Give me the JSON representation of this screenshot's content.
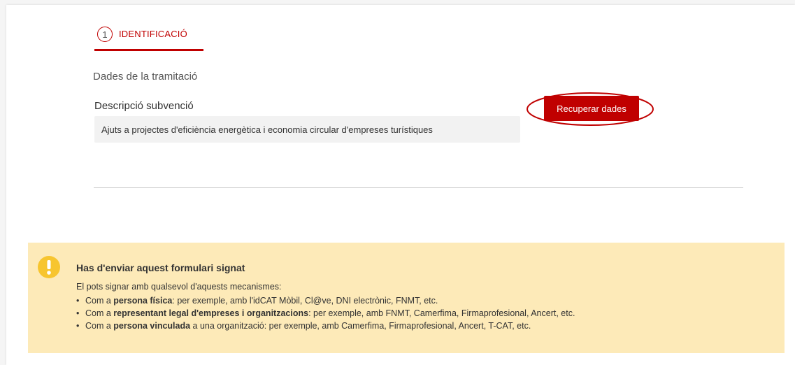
{
  "step": {
    "number": "1",
    "label": "IDENTIFICACIÓ"
  },
  "section": {
    "title": "Dades de la tramitació"
  },
  "field": {
    "label": "Descripció subvenció",
    "value": "Ajuts a projectes d'eficiència energètica i economia circular d'empreses turístiques"
  },
  "actions": {
    "recover_label": "Recuperar dades"
  },
  "notice": {
    "icon": "exclamation-icon",
    "title": "Has d'enviar aquest formulari signat",
    "intro": "El pots signar amb qualsevol d'aquests mecanismes:",
    "items": [
      {
        "prefix": "Com a ",
        "bold": "persona física",
        "suffix": ": per exemple, amb l'idCAT Mòbil, Cl@ve, DNI electrònic, FNMT, etc."
      },
      {
        "prefix": "Com a ",
        "bold": "representant legal d'empreses i organitzacions",
        "suffix": ": per exemple, amb FNMT, Camerfima, Firmaprofesional, Ancert, etc."
      },
      {
        "prefix": "Com a ",
        "bold": "persona vinculada",
        "suffix": " a una organització: per exemple, amb Camerfima, Firmaprofesional, Ancert, T-CAT, etc."
      }
    ]
  },
  "colors": {
    "accent": "#c00000",
    "notice_bg": "#fdeab8",
    "notice_icon": "#f7c52f"
  }
}
